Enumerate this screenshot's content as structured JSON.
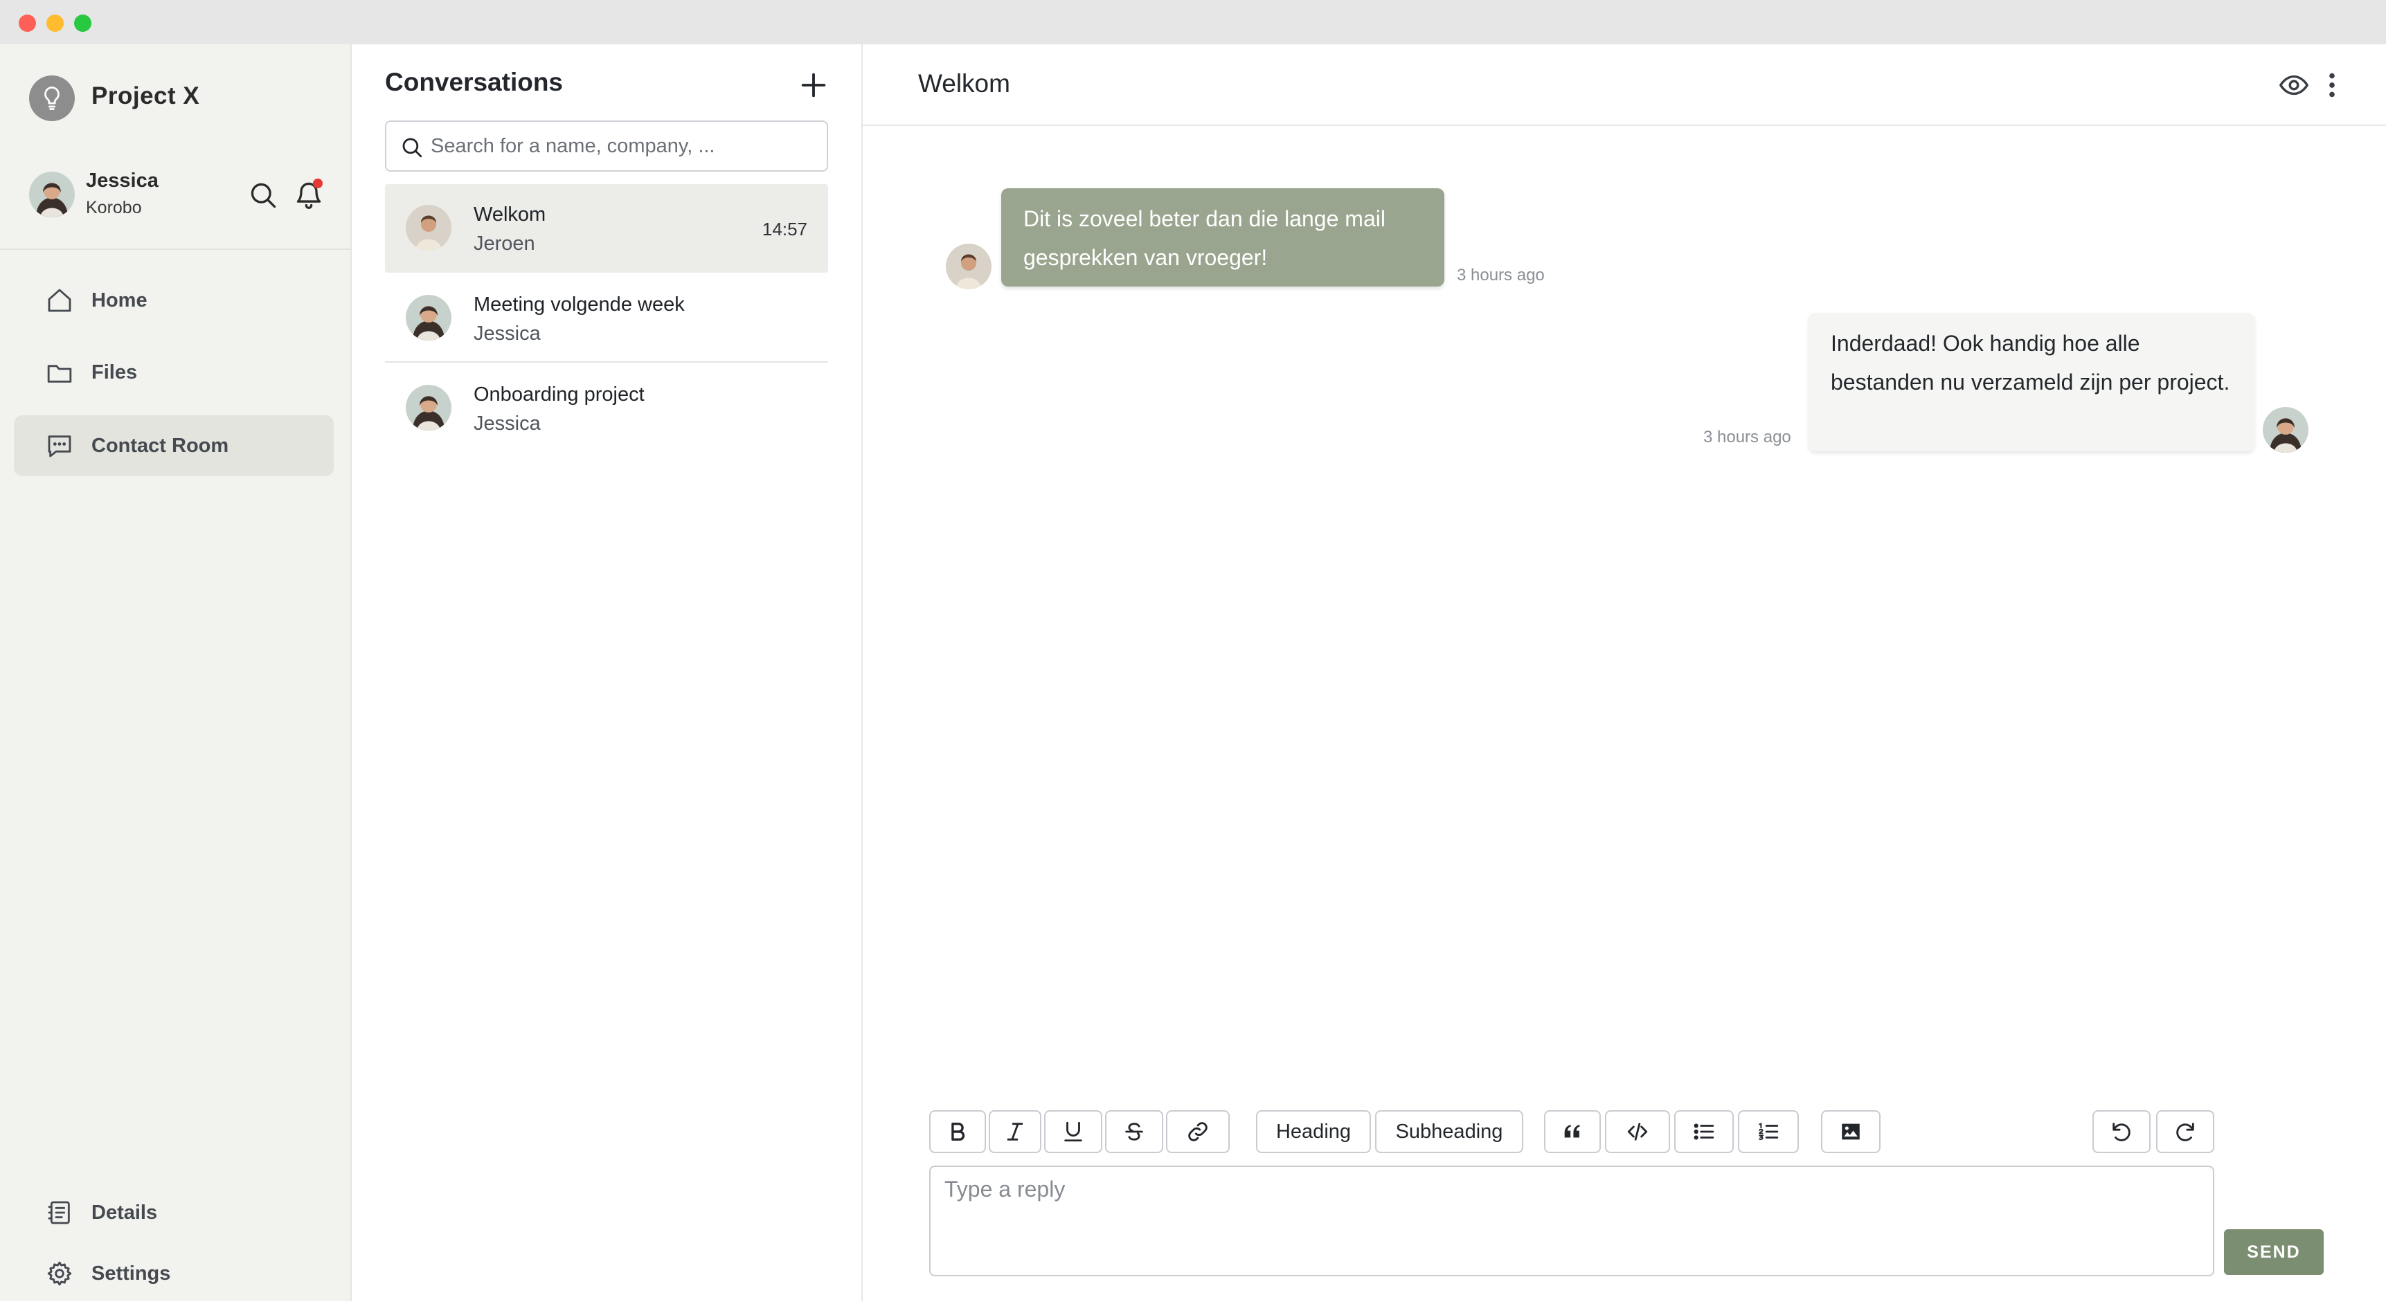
{
  "window": {
    "controls": [
      "close",
      "minimize",
      "zoom"
    ]
  },
  "sidebar": {
    "brand": {
      "name": "Project X",
      "icon": "lightbulb-icon"
    },
    "user": {
      "name": "Jessica",
      "company": "Korobo"
    },
    "header_icons": [
      "search-icon",
      "bell-icon"
    ],
    "notification_dot_color": "#e53935",
    "nav": [
      {
        "label": "Home",
        "icon": "home-icon",
        "active": false
      },
      {
        "label": "Files",
        "icon": "folder-icon",
        "active": false
      },
      {
        "label": "Contact Room",
        "icon": "chat-icon",
        "active": true
      }
    ],
    "footer_nav": [
      {
        "label": "Details",
        "icon": "details-icon"
      },
      {
        "label": "Settings",
        "icon": "gear-icon"
      }
    ]
  },
  "conversations": {
    "title": "Conversations",
    "search_placeholder": "Search for a name, company, ...",
    "items": [
      {
        "title": "Welkom",
        "sender": "Jeroen",
        "time": "14:57",
        "active": true
      },
      {
        "title": "Meeting volgende week",
        "sender": "Jessica",
        "time": "",
        "active": false
      },
      {
        "title": "Onboarding project",
        "sender": "Jessica",
        "time": "",
        "active": false
      }
    ]
  },
  "chat": {
    "title": "Welkom",
    "messages": [
      {
        "direction": "incoming",
        "text": "Dit is zoveel beter dan die lange mail gesprekken van vroeger!",
        "time": "3 hours ago"
      },
      {
        "direction": "outgoing",
        "text": "Inderdaad! Ook handig hoe alle bestanden nu verzameld zijn per project.",
        "time": "3 hours ago"
      }
    ],
    "toolbar": {
      "format_icons": [
        "bold-icon",
        "italic-icon",
        "underline-icon",
        "strikethrough-icon",
        "link-icon"
      ],
      "heading_label": "Heading",
      "subheading_label": "Subheading",
      "block_icons": [
        "quote-icon",
        "code-icon",
        "bullet-list-icon",
        "numbered-list-icon",
        "image-icon"
      ],
      "history_icons": [
        "undo-icon",
        "redo-icon"
      ]
    },
    "reply_placeholder": "Type a reply",
    "send_label": "SEND"
  },
  "colors": {
    "accent": "#7b8e71",
    "incoming_bubble": "#9aa58f",
    "sidebar_bg": "#f2f2ef",
    "active_nav": "#e4e4df"
  }
}
